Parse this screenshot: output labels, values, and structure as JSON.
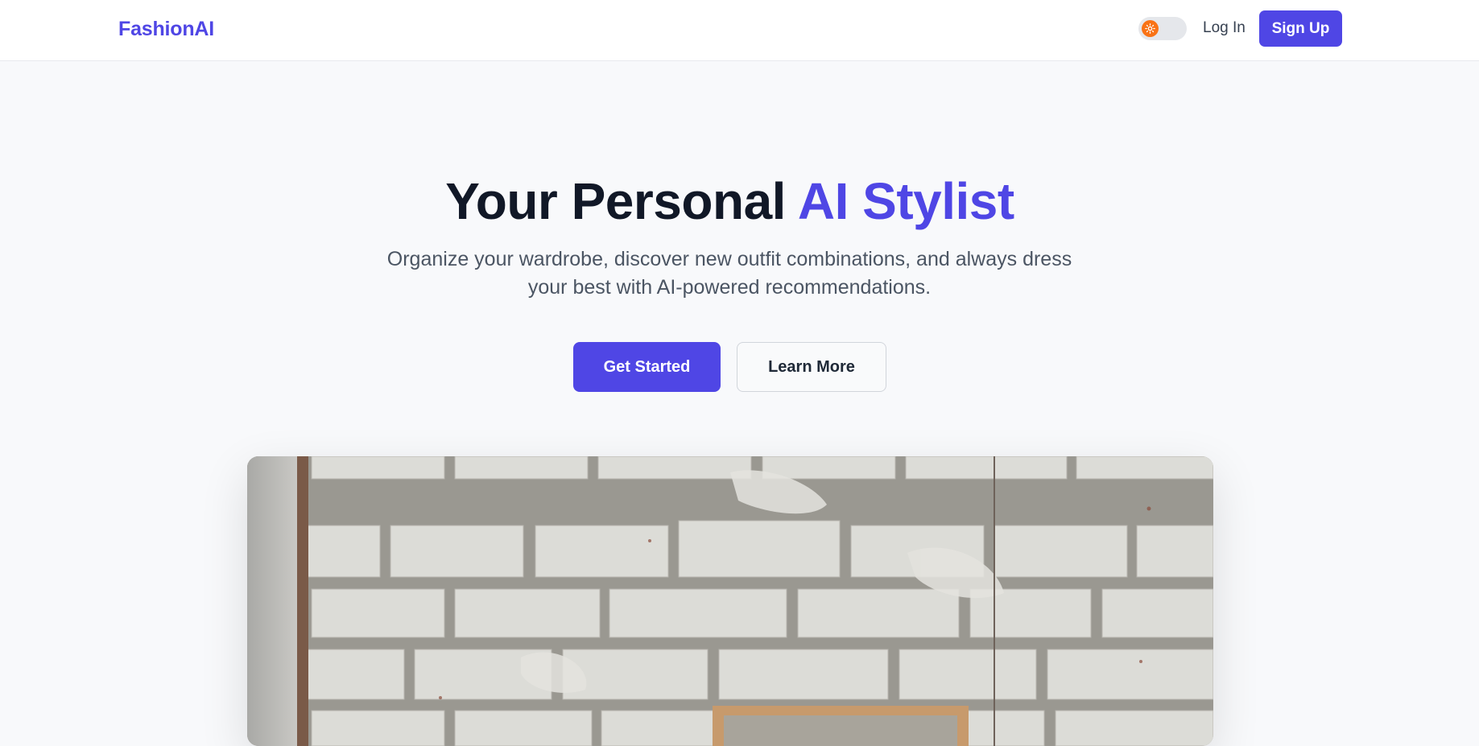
{
  "nav": {
    "brand": "FashionAI",
    "login_label": "Log In",
    "signup_label": "Sign Up",
    "theme_toggle_icon": "sun-icon"
  },
  "hero": {
    "title_main": "Your Personal ",
    "title_accent": "AI Stylist",
    "subtitle_line1": "Organize your wardrobe, discover new outfit combinations, and always dress",
    "subtitle_line2": "your best with AI-powered recommendations.",
    "primary_cta": "Get Started",
    "secondary_cta": "Learn More"
  },
  "colors": {
    "brand": "#4f46e5",
    "toggle_knob": "#f97316",
    "background": "#f8f9fb"
  }
}
